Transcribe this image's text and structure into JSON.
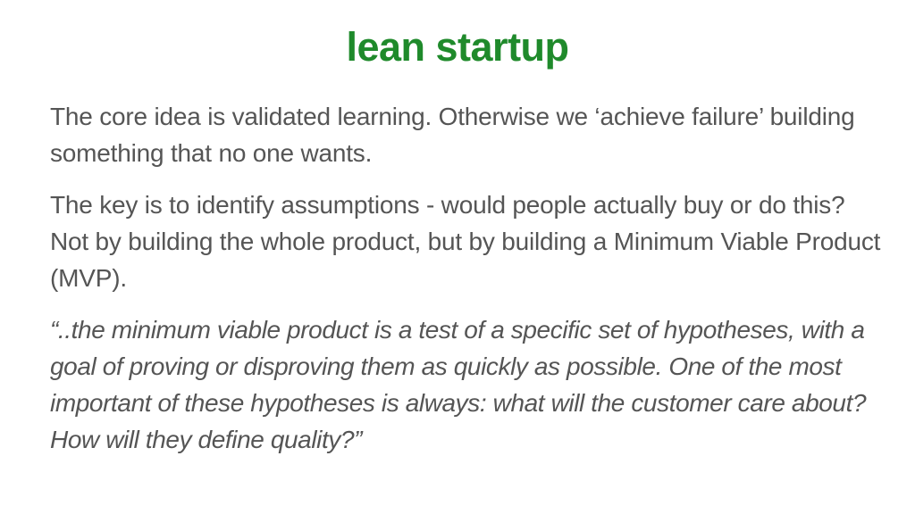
{
  "slide": {
    "title": "lean startup",
    "title_color": "#1f8a2b",
    "text_color": "#555555",
    "paragraphs": [
      "The core idea is validated learning. Otherwise we ‘achieve failure’ building something that no one wants.",
      "The key is to identify assumptions - would people actually buy or do this? Not by building the whole product, but by building a Minimum Viable Product (MVP)."
    ],
    "quote": "“..the minimum viable product is a test of a specific set of hypotheses, with a goal of proving or disproving them as quickly as possible. One of the most important of these hypotheses is always: what will the customer care about? How will they define quality?”"
  }
}
